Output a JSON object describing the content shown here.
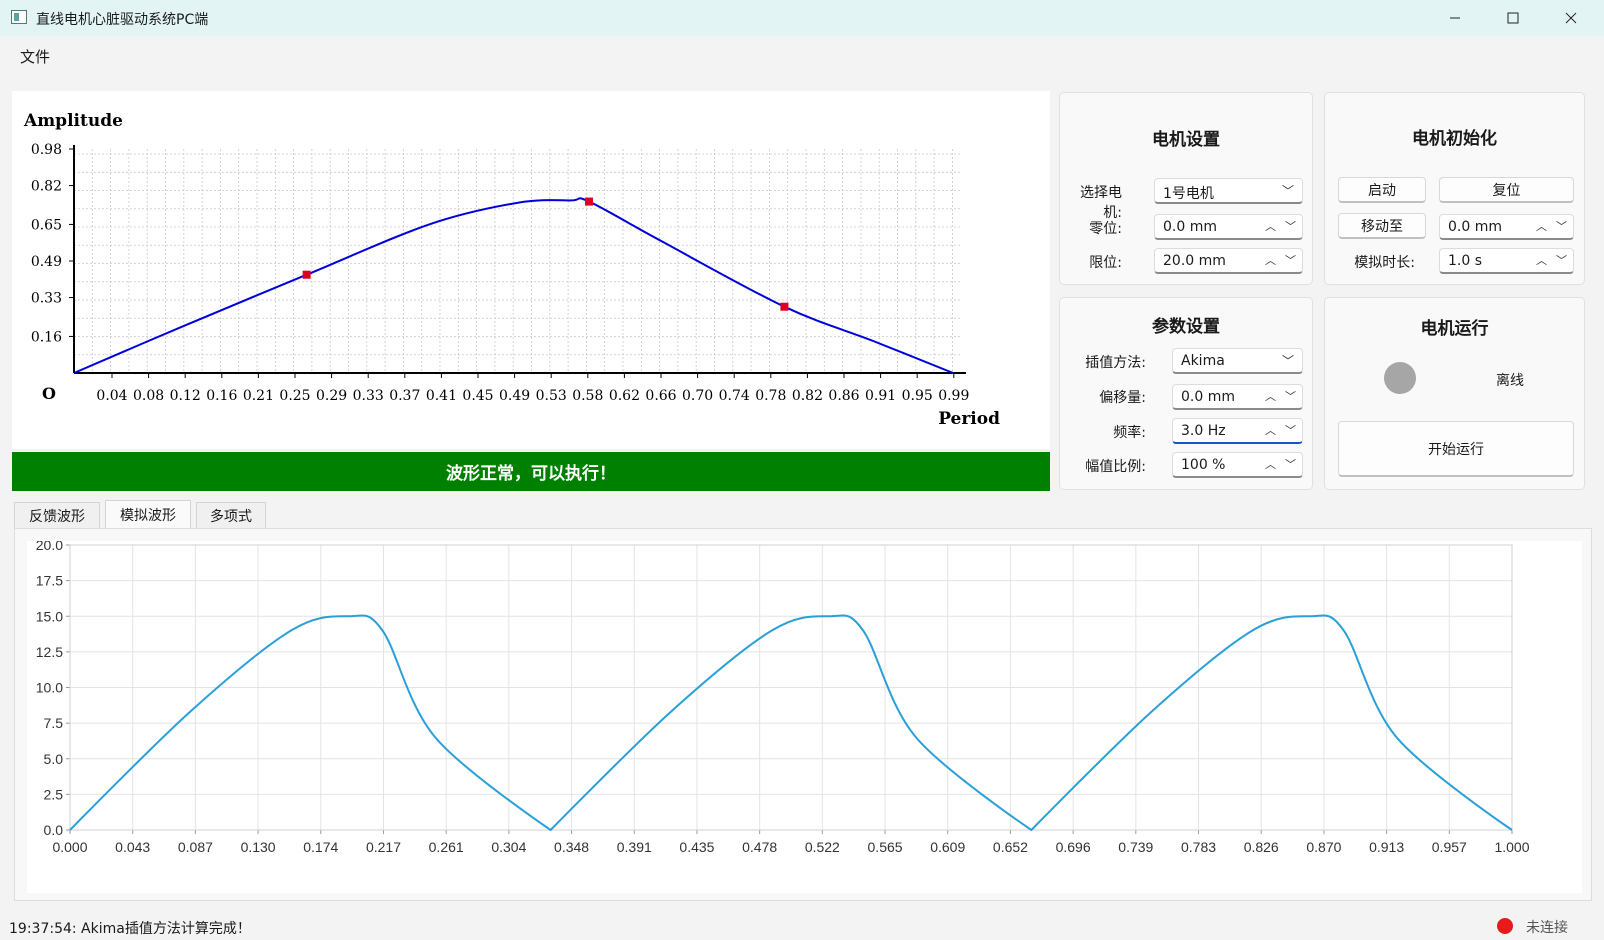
{
  "window": {
    "title": "直线电机心脏驱动系统PC端"
  },
  "menu": {
    "file": "文件"
  },
  "curve_chart": {
    "ylabel": "Amplitude",
    "xlabel": "Period",
    "origin_label": "O",
    "y_ticks": [
      "0.98",
      "0.82",
      "0.65",
      "0.49",
      "0.33",
      "0.16"
    ],
    "x_ticks": [
      "0.04",
      "0.08",
      "0.12",
      "0.16",
      "0.21",
      "0.25",
      "0.29",
      "0.33",
      "0.37",
      "0.41",
      "0.45",
      "0.49",
      "0.53",
      "0.58",
      "0.62",
      "0.66",
      "0.70",
      "0.74",
      "0.78",
      "0.82",
      "0.86",
      "0.91",
      "0.95",
      "0.99"
    ],
    "control_points": [
      {
        "x": 0.0,
        "y": 0.0
      },
      {
        "x": 0.262,
        "y": 0.43
      },
      {
        "x": 0.58,
        "y": 0.75
      },
      {
        "x": 0.8,
        "y": 0.29
      },
      {
        "x": 0.99,
        "y": 0.0
      }
    ],
    "curve_color": "#0000dd",
    "point_color": "#dd0022"
  },
  "banner": {
    "text": "波形正常，可以执行！",
    "color": "#008000"
  },
  "motor_settings": {
    "title": "电机设置",
    "select_label": "选择电机:",
    "select_value": "1号电机",
    "zero_label": "零位:",
    "zero_value": "0.0 mm",
    "limit_label": "限位:",
    "limit_value": "20.0 mm"
  },
  "motor_init": {
    "title": "电机初始化",
    "start_button": "启动",
    "reset_button": "复位",
    "move_button": "移动至",
    "move_value": "0.0 mm",
    "sim_label": "模拟时长:",
    "sim_value": "1.0 s"
  },
  "params": {
    "title": "参数设置",
    "interp_label": "插值方法:",
    "interp_value": "Akima",
    "offset_label": "偏移量:",
    "offset_value": "0.0 mm",
    "freq_label": "频率:",
    "freq_value": "3.0 Hz",
    "amp_label": "幅值比例:",
    "amp_value": "100 %"
  },
  "motor_run": {
    "title": "电机运行",
    "status": "离线",
    "run_button": "开始运行"
  },
  "tabs": [
    {
      "label": "反馈波形"
    },
    {
      "label": "模拟波形"
    },
    {
      "label": "多项式"
    }
  ],
  "chart_data": {
    "type": "line",
    "x_ticks": [
      "0.000",
      "0.043",
      "0.087",
      "0.130",
      "0.174",
      "0.217",
      "0.261",
      "0.304",
      "0.348",
      "0.391",
      "0.435",
      "0.478",
      "0.522",
      "0.565",
      "0.609",
      "0.652",
      "0.696",
      "0.739",
      "0.783",
      "0.826",
      "0.870",
      "0.913",
      "0.957",
      "1.000"
    ],
    "y_ticks": [
      "20.0",
      "17.5",
      "15.0",
      "12.5",
      "10.0",
      "7.5",
      "5.0",
      "2.5",
      "0.0"
    ],
    "xlim": [
      0,
      1
    ],
    "ylim": [
      0,
      20
    ],
    "grid": true,
    "series": [
      {
        "color": "#2a9fd8",
        "x": [
          0.0,
          0.0833,
          0.1533,
          0.1933,
          0.2167,
          0.2533,
          0.3333,
          0.4167,
          0.4867,
          0.5267,
          0.55,
          0.5867,
          0.6667,
          0.75,
          0.82,
          0.86,
          0.8833,
          0.92,
          1.0
        ],
        "y": [
          0.0,
          8.3,
          14.0,
          15.0,
          14.0,
          6.5,
          0.0,
          8.3,
          14.0,
          15.0,
          14.0,
          6.5,
          0.0,
          8.3,
          14.0,
          15.0,
          14.0,
          6.5,
          0.0
        ]
      }
    ]
  },
  "statusbar": {
    "message": "19:37:54: Akima插值方法计算完成！",
    "connection": "未连接"
  }
}
